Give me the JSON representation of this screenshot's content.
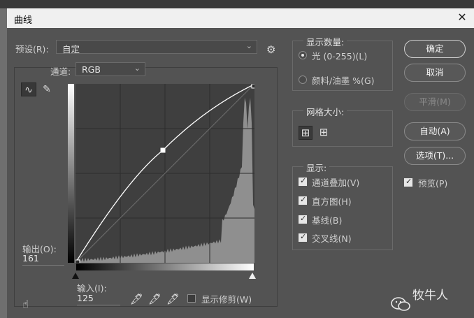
{
  "dialog": {
    "title": "曲线",
    "close_glyph": "✕"
  },
  "preset": {
    "label": "预设(R):",
    "value": "自定",
    "arrow": "⌄"
  },
  "gear_glyph": "⚙",
  "channel": {
    "label": "通道:",
    "value": "RGB",
    "arrow": "⌄"
  },
  "tools": {
    "curve_glyph": "∿",
    "pencil_glyph": "✎"
  },
  "output": {
    "label": "输出(O):",
    "value": "161"
  },
  "input": {
    "label": "输入(I):",
    "value": "125"
  },
  "pickers": [
    "🖋",
    "🖋",
    "🖋"
  ],
  "clipping": {
    "label": "显示修剪(W)",
    "checked": false
  },
  "display_amount": {
    "title": "显示数量:",
    "options": [
      {
        "label": "光 (0-255)(L)",
        "selected": true
      },
      {
        "label": "颜料/油墨 %(G)",
        "selected": false
      }
    ]
  },
  "grid_size": {
    "title": "网格大小:",
    "glyph_small": "⊞",
    "glyph_large": "⊞",
    "active": "small"
  },
  "show": {
    "title": "显示:",
    "options": [
      {
        "label": "通道叠加(V)",
        "checked": true
      },
      {
        "label": "直方图(H)",
        "checked": true
      },
      {
        "label": "基线(B)",
        "checked": true
      },
      {
        "label": "交叉线(N)",
        "checked": true
      }
    ]
  },
  "buttons": {
    "ok": "确定",
    "cancel": "取消",
    "smooth": "平滑(M)",
    "auto": "自动(A)",
    "options": "选项(T)..."
  },
  "preview": {
    "label": "预览(P)",
    "checked": true
  },
  "curve": {
    "points": [
      [
        0,
        0
      ],
      [
        125,
        161
      ],
      [
        255,
        255
      ]
    ]
  },
  "watermark": {
    "text": "牧牛人"
  },
  "colors": {
    "panel": "#535353",
    "graph_bg": "#3f3f3f",
    "histogram": "#8f8f8f",
    "curve": "#ffffff"
  }
}
